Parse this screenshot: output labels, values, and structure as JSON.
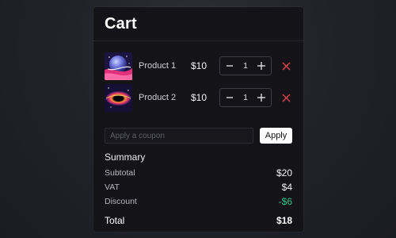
{
  "cart": {
    "title": "Cart",
    "items": [
      {
        "name": "Product 1",
        "price": "$10",
        "quantity": "1",
        "thumbnail": "planet-artwork"
      },
      {
        "name": "Product 2",
        "price": "$10",
        "quantity": "1",
        "thumbnail": "black-hole-artwork"
      }
    ],
    "coupon": {
      "placeholder": "Apply a coupon",
      "value": "",
      "apply_label": "Apply"
    },
    "summary": {
      "title": "Summary",
      "subtotal_label": "Subtotal",
      "subtotal_value": "$20",
      "vat_label": "VAT",
      "vat_value": "$4",
      "discount_label": "Discount",
      "discount_value": "-$6",
      "total_label": "Total",
      "total_value": "$18"
    }
  },
  "icons": {
    "minus": "minus-icon",
    "plus": "plus-icon",
    "remove": "close-icon"
  },
  "colors": {
    "accent_remove": "#e0454f",
    "discount": "#33c28a",
    "panel_bg": "#141418"
  }
}
